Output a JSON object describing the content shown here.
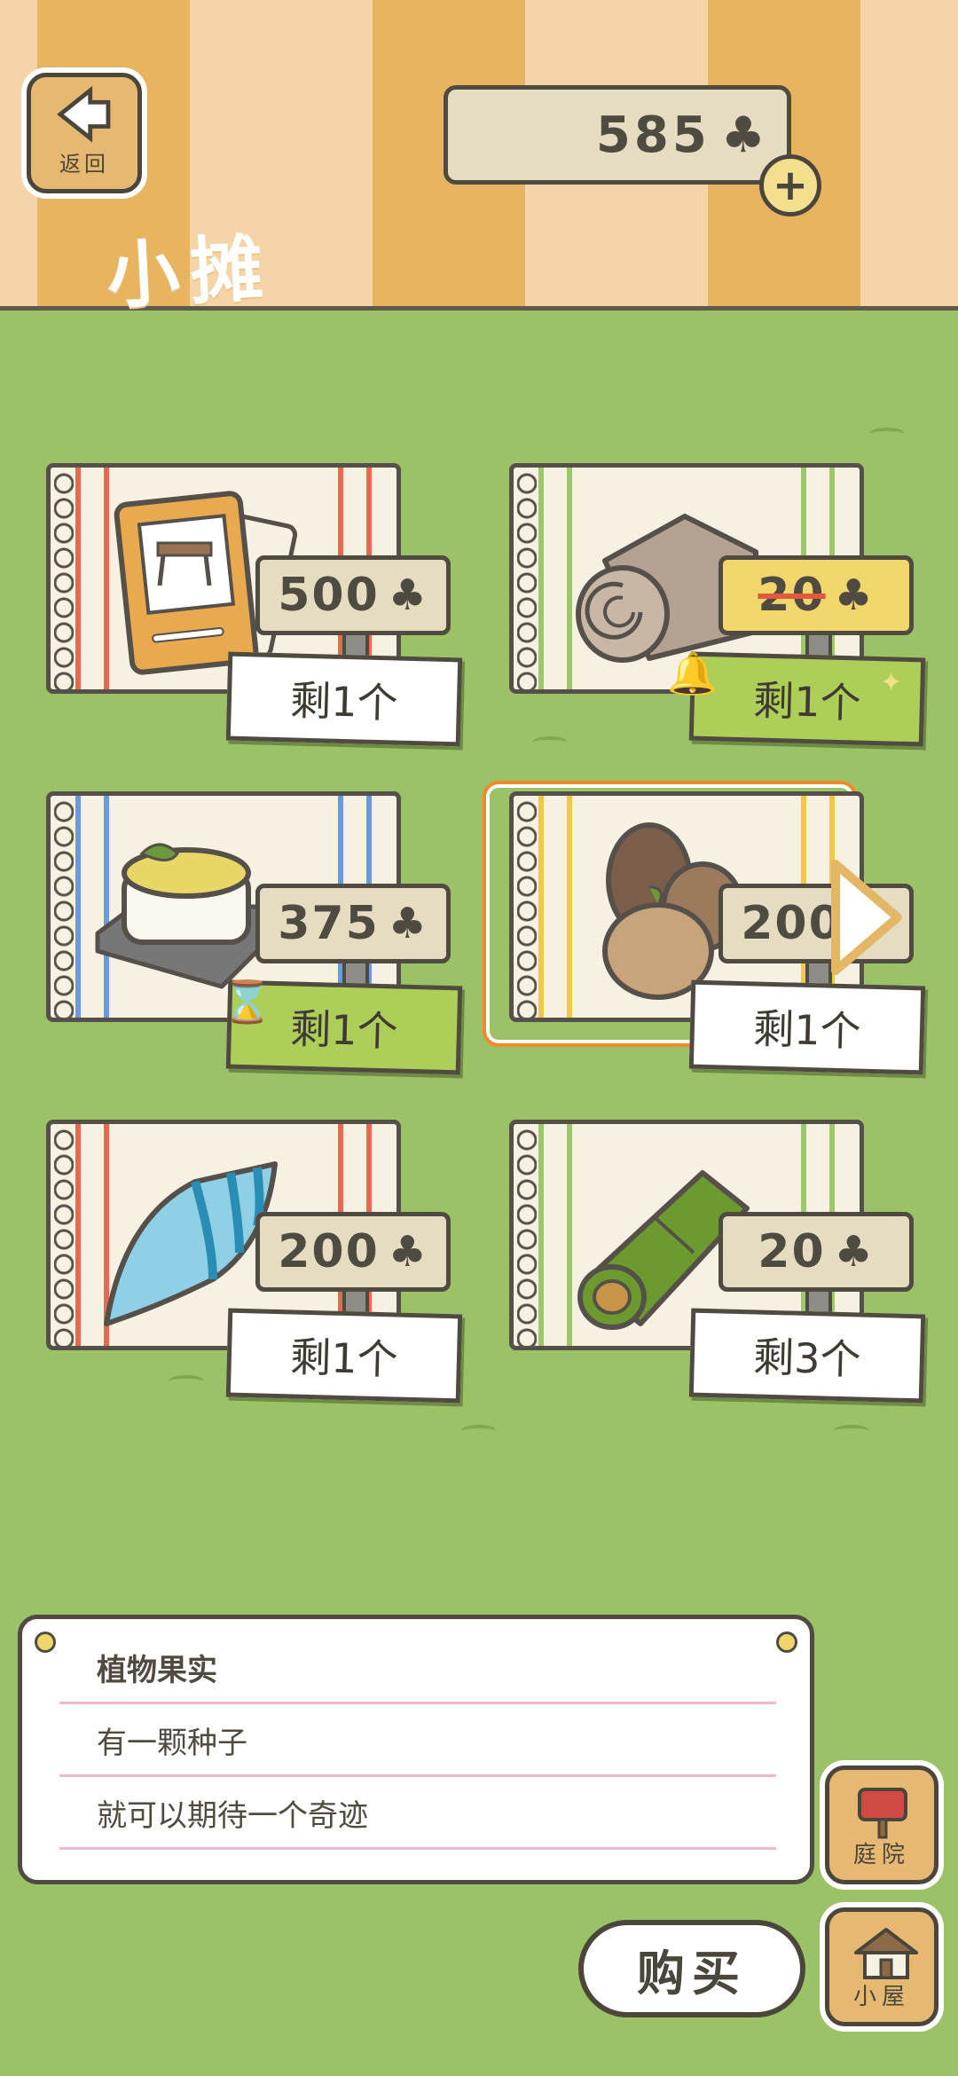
{
  "header": {
    "back_label": "返回",
    "title": "小摊",
    "currency_amount": "585",
    "plus_label": "+"
  },
  "items": [
    {
      "name": "table-blueprint",
      "price": "500",
      "stock": "剩1个",
      "stripe": "#e8694f",
      "sale": false,
      "special": false
    },
    {
      "name": "rolled-blanket",
      "price": "20",
      "stock": "剩1个",
      "stripe": "#9fc86d",
      "sale": true,
      "special": true
    },
    {
      "name": "pudding-dish",
      "price": "375",
      "stock": "剩1个",
      "stripe": "#6a9ae0",
      "sale": false,
      "special": true
    },
    {
      "name": "nuts-and-seeds",
      "price": "200",
      "stock": "剩1个",
      "stripe": "#f2c84b",
      "sale": false,
      "special": false,
      "selected": true
    },
    {
      "name": "sea-shell",
      "price": "200",
      "stock": "剩1个",
      "stripe": "#e8694f",
      "sale": false,
      "special": false
    },
    {
      "name": "bamboo",
      "price": "20",
      "stock": "剩3个",
      "stripe": "#9fc86d",
      "sale": false,
      "special": false
    }
  ],
  "description": {
    "title": "植物果实",
    "line1": "有一颗种子",
    "line2": "就可以期待一个奇迹"
  },
  "buttons": {
    "yard_label": "庭院",
    "house_label": "小屋",
    "buy_label": "购买"
  },
  "colors": {
    "grass": "#9bc266",
    "awning_orange": "#e9b45f",
    "awning_cream": "#f5d5a7",
    "selected_frame": "#f08a2a",
    "sale_tag": "#f1d66b",
    "special_stock": "#aece5a"
  }
}
